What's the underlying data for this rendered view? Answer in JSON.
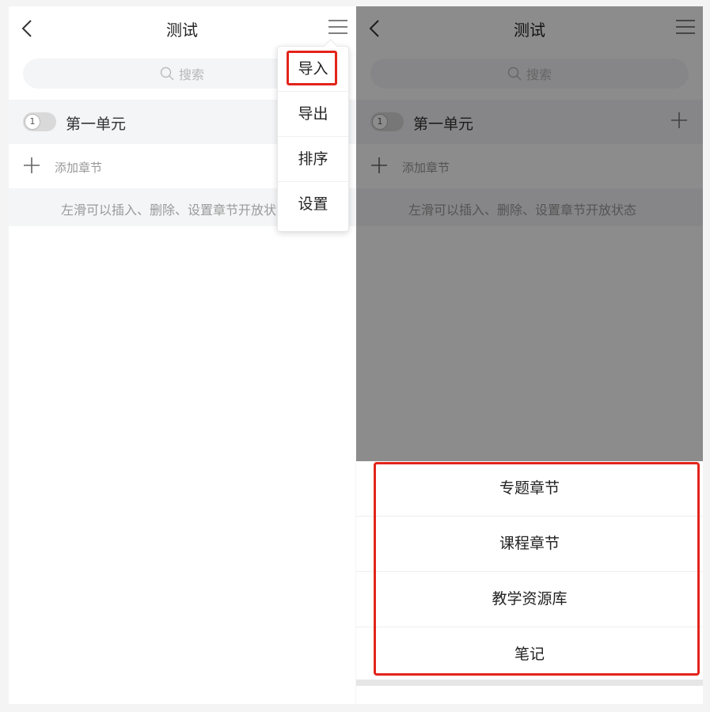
{
  "left": {
    "title": "测试",
    "search_placeholder": "搜索",
    "unit_number": "1",
    "unit_label": "第一单元",
    "add_chapter_label": "添加章节",
    "hint": "左滑可以插入、删除、设置章节开放状态",
    "menu_items": [
      "导入",
      "导出",
      "排序",
      "设置"
    ]
  },
  "right": {
    "title": "测试",
    "search_placeholder": "搜索",
    "unit_number": "1",
    "unit_label": "第一单元",
    "add_chapter_label": "添加章节",
    "hint": "左滑可以插入、删除、设置章节开放状态",
    "sheet_options": [
      "专题章节",
      "课程章节",
      "教学资源库",
      "笔记"
    ]
  },
  "colors": {
    "highlight": "#e3241b",
    "overlay": "rgba(0,0,0,0.45)"
  }
}
